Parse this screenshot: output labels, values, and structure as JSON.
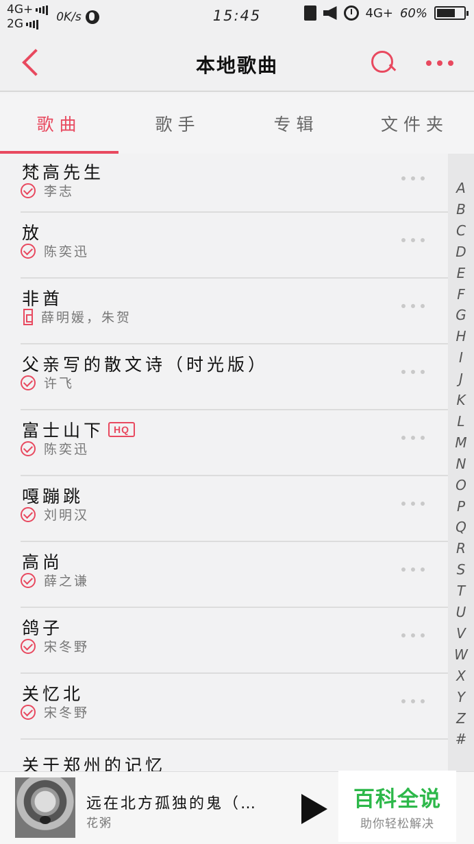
{
  "status_bar": {
    "network_top": "4G+",
    "network_bottom": "2G",
    "speed": "0K/s",
    "time": "15:45",
    "network_right": "4G+",
    "battery": "60%"
  },
  "header": {
    "title": "本地歌曲"
  },
  "tabs": [
    {
      "label": "歌曲",
      "active": true
    },
    {
      "label": "歌手",
      "active": false
    },
    {
      "label": "专辑",
      "active": false
    },
    {
      "label": "文件夹",
      "active": false
    }
  ],
  "songs": [
    {
      "title": "梵高先生",
      "artist": "李志",
      "hq": false,
      "badge_icon": "check-circle-icon"
    },
    {
      "title": "放",
      "artist": "陈奕迅",
      "hq": false,
      "badge_icon": "check-circle-icon"
    },
    {
      "title": "非酋",
      "artist": "薛明媛，朱贺",
      "hq": false,
      "badge_icon": "local-file-icon"
    },
    {
      "title": "父亲写的散文诗（时光版）",
      "artist": "许飞",
      "hq": false,
      "badge_icon": "check-circle-icon"
    },
    {
      "title": "富士山下",
      "artist": "陈奕迅",
      "hq": true,
      "badge_icon": "check-circle-icon"
    },
    {
      "title": "嘎蹦跳",
      "artist": "刘明汉",
      "hq": false,
      "badge_icon": "check-circle-icon"
    },
    {
      "title": "高尚",
      "artist": "薛之谦",
      "hq": false,
      "badge_icon": "check-circle-icon"
    },
    {
      "title": "鸽子",
      "artist": "宋冬野",
      "hq": false,
      "badge_icon": "check-circle-icon"
    },
    {
      "title": "关忆北",
      "artist": "宋冬野",
      "hq": false,
      "badge_icon": "check-circle-icon"
    },
    {
      "title": "关于郑州的记忆",
      "artist": "",
      "hq": false,
      "badge_icon": "check-circle-icon"
    }
  ],
  "hq_label": "HQ",
  "alphabet": [
    "A",
    "B",
    "C",
    "D",
    "E",
    "F",
    "G",
    "H",
    "I",
    "J",
    "K",
    "L",
    "M",
    "N",
    "O",
    "P",
    "Q",
    "R",
    "S",
    "T",
    "U",
    "V",
    "W",
    "X",
    "Y",
    "Z",
    "#"
  ],
  "now_playing": {
    "title": "远在北方孤独的鬼（…",
    "artist": "花粥"
  },
  "watermark": {
    "main": "百科全说",
    "sub": "助你轻松解决"
  },
  "colors": {
    "accent": "#e8495f",
    "watermark_green": "#2db84a"
  }
}
